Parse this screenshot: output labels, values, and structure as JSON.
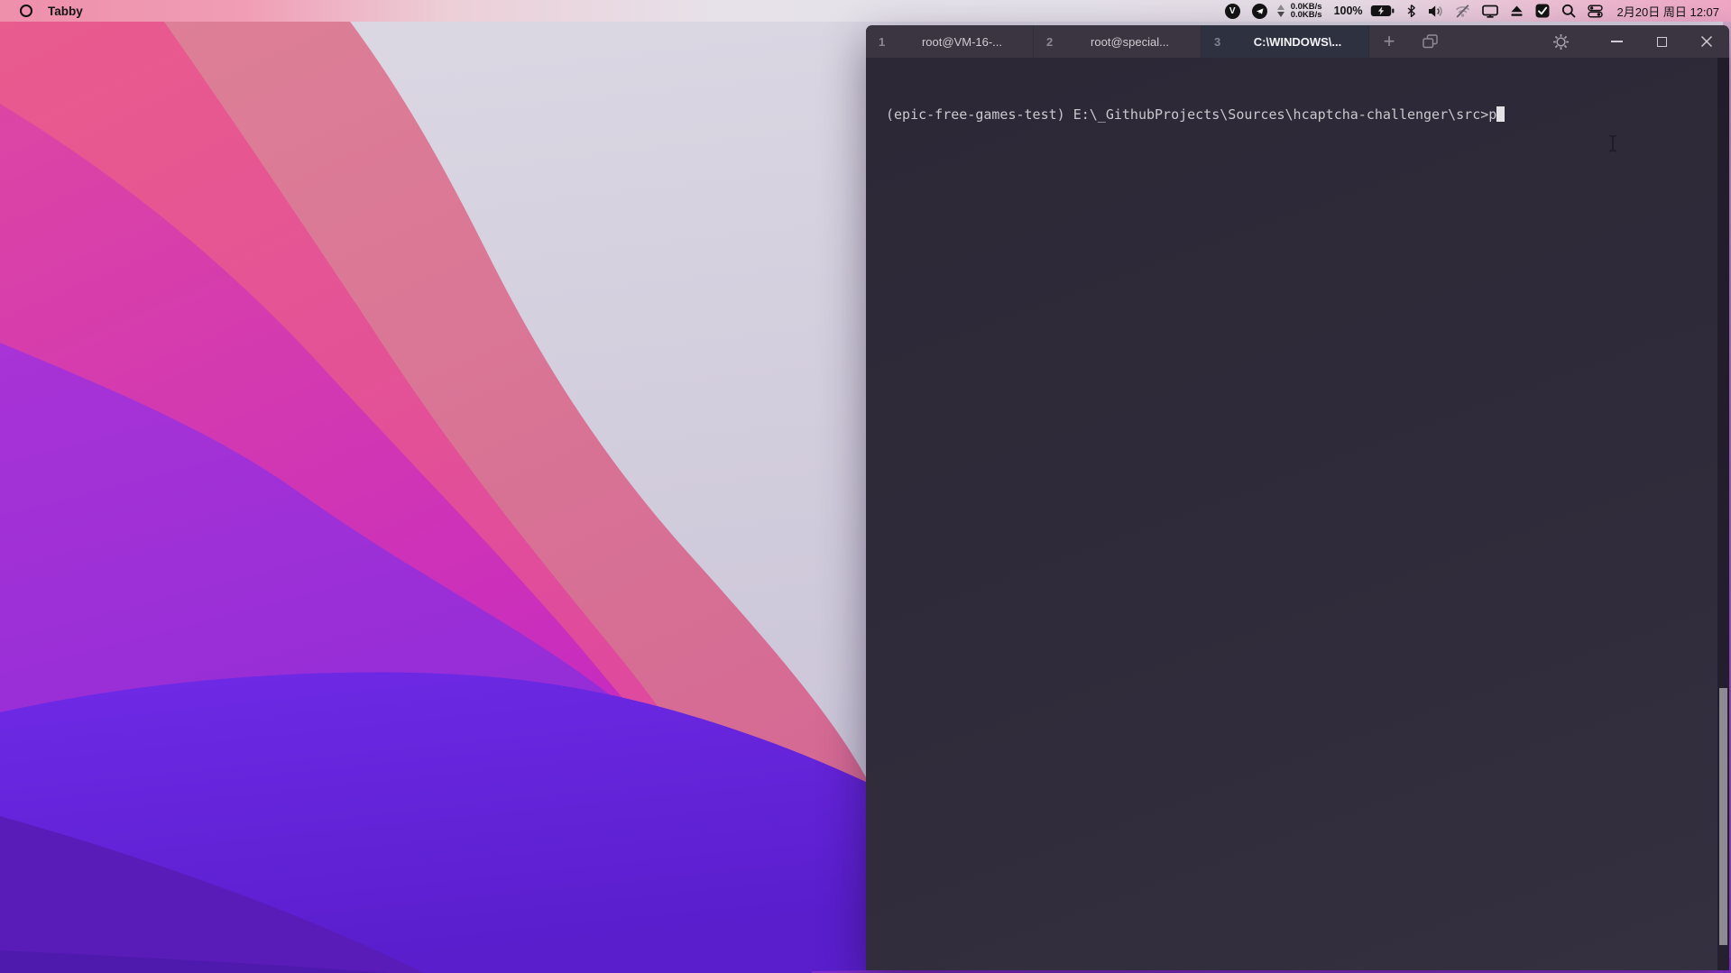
{
  "menu_bar": {
    "app_name": "Tabby",
    "proxy_letter": "V",
    "net_up": "0.0KB/s",
    "net_down": "0.0KB/s",
    "battery_percent": "100%",
    "datetime": "2月20日 周日 12:07",
    "icons": [
      "app-logo-ring-icon",
      "proxy-v-icon",
      "telegram-icon",
      "network-arrows-icon",
      "battery-charging-icon",
      "bluetooth-icon",
      "volume-icon",
      "wifi-off-icon",
      "display-icon",
      "eject-icon",
      "tasks-check-icon",
      "search-icon",
      "control-center-icon"
    ]
  },
  "window": {
    "tab_bar": {
      "tabs": [
        {
          "index": "1",
          "label": "root@VM-16-..."
        },
        {
          "index": "2",
          "label": "root@special..."
        },
        {
          "index": "3",
          "label": "C:\\WINDOWS\\..."
        }
      ],
      "new_tab_label": "+"
    },
    "terminal": {
      "prompt": "(epic-free-games-test) E:\\_GithubProjects\\Sources\\hcaptcha-challenger\\src>p"
    }
  },
  "colors": {
    "menubar_pink": "#ee8fac",
    "tabbar_bg": "#3a3541",
    "active_tab_bg": "#2d3140",
    "terminal_bg": "#2f2b3a",
    "cursor": "#e3e3e6",
    "wallpaper_rose": "#e4538f",
    "wallpaper_magenta": "#c427c4",
    "wallpaper_purple": "#9a2fd6",
    "wallpaper_violet": "#6a28e2",
    "wallpaper_deep_violet": "#5a1cb8",
    "wallpaper_light": "#d5d1de"
  }
}
